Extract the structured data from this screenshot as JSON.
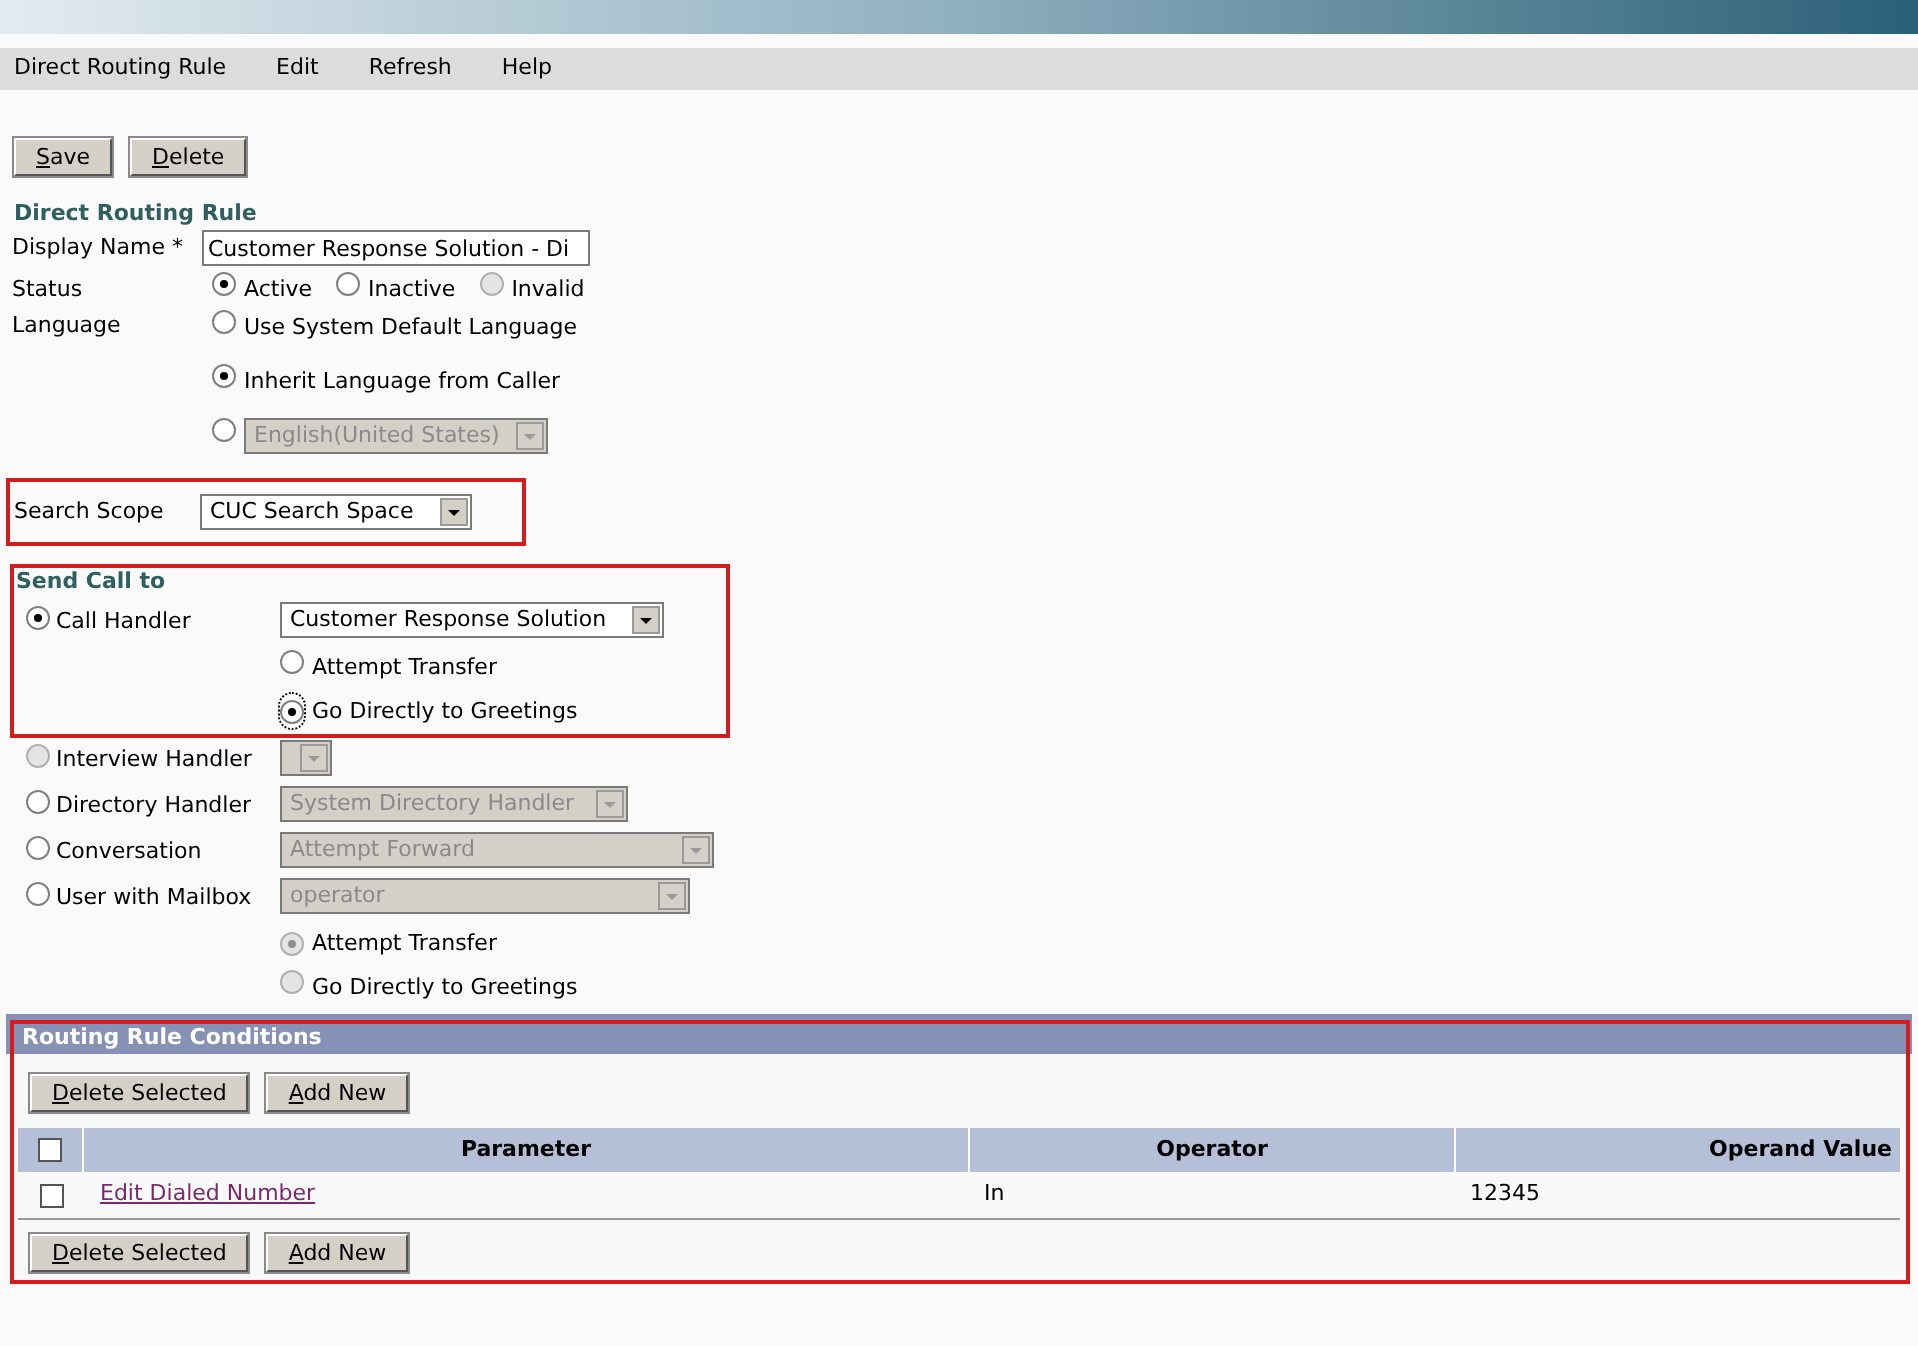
{
  "menu": [
    {
      "label": "Direct Routing Rule"
    },
    {
      "label": "Edit"
    },
    {
      "label": "Refresh"
    },
    {
      "label": "Help"
    }
  ],
  "toolbar": [
    {
      "label": "Save"
    },
    {
      "label": "Delete"
    }
  ],
  "section_title": "Direct Routing Rule",
  "display_name": {
    "label": "Display Name *",
    "value": "Customer Response Solution - Di"
  },
  "status": {
    "label": "Status",
    "options": [
      {
        "label": "Active",
        "selected": true,
        "disabled": false
      },
      {
        "label": "Inactive",
        "selected": false,
        "disabled": false
      },
      {
        "label": "Invalid",
        "selected": false,
        "disabled": true
      }
    ]
  },
  "language": {
    "label": "Language",
    "options": [
      {
        "kind": "text",
        "label": "Use System Default Language",
        "selected": false
      },
      {
        "kind": "text",
        "label": "Inherit Language from Caller",
        "selected": true
      },
      {
        "kind": "select",
        "value": "English(United States)",
        "selected": false
      }
    ]
  },
  "search_scope": {
    "label": "Search Scope",
    "value": "CUC Search Space"
  },
  "send_call_to": {
    "title": "Send Call to",
    "targets": [
      {
        "label": "Call Handler",
        "selected": true,
        "disabled": false,
        "select": {
          "value": "Customer Response Solution",
          "disabled": false
        },
        "options": [
          {
            "label": "Attempt Transfer",
            "selected": false,
            "disabled": false
          },
          {
            "label": "Go Directly to Greetings",
            "selected": true,
            "disabled": false
          }
        ]
      },
      {
        "label": "Interview Handler",
        "selected": false,
        "disabled": true,
        "select": {
          "disabled": true
        }
      },
      {
        "label": "Directory Handler",
        "selected": false,
        "disabled": false,
        "select": {
          "value": "System Directory Handler",
          "disabled": true
        }
      },
      {
        "label": "Conversation",
        "selected": false,
        "disabled": false,
        "select": {
          "value": "Attempt Forward",
          "disabled": true
        }
      },
      {
        "label": "User with Mailbox",
        "selected": false,
        "disabled": false,
        "select": {
          "value": "operator",
          "disabled": true
        },
        "options": [
          {
            "label": "Attempt Transfer",
            "selected": true,
            "disabled": true
          },
          {
            "label": "Go Directly to Greetings",
            "selected": false,
            "disabled": true
          }
        ]
      }
    ]
  },
  "conditions": {
    "title": "Routing Rule Conditions",
    "buttons": [
      {
        "label": "Delete Selected"
      },
      {
        "label": "Add New"
      }
    ],
    "select_all_checked": false,
    "columns": [
      "Parameter",
      "Operator",
      "Operand Value"
    ],
    "rows": [
      {
        "checked": false,
        "parameter": "Edit Dialed Number",
        "operator": "In",
        "operand_value": "12345"
      }
    ],
    "bottom_buttons": [
      {
        "label": "Delete Selected"
      },
      {
        "label": "Add New"
      }
    ]
  }
}
